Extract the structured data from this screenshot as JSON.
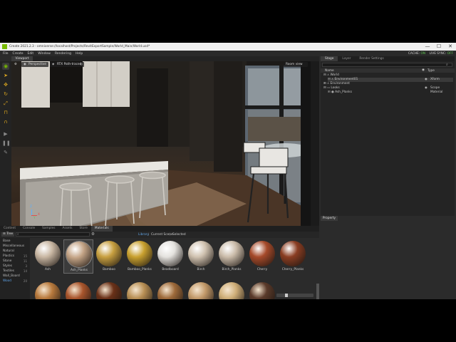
{
  "window": {
    "title": "Create 2021.2.3 - omniverse://localhost/Projects/RevitExportSample/World_Main/World.usd*",
    "controls": [
      "—",
      "☐",
      "✕"
    ]
  },
  "menu": {
    "items": [
      "File",
      "Create",
      "Edit",
      "Window",
      "Rendering",
      "Help"
    ],
    "cache_label": "CACHE:",
    "cache_value": "ON",
    "live_sync_label": "LIVE SYNC:",
    "live_sync_value": "OFF"
  },
  "viewport": {
    "tab_label": "Viewport",
    "camera": "Perspective",
    "renderer": "RTX Path-traced",
    "overlay": "Room view",
    "axis_z": "Z",
    "axis_x": "X",
    "axis_y": "Y"
  },
  "stage": {
    "tabs": [
      "Stage",
      "Layer",
      "Render Settings"
    ],
    "active_tab": "Stage",
    "columns": [
      "Name",
      "Type"
    ],
    "rows": [
      {
        "name": "World",
        "type": "",
        "indent": 0
      },
      {
        "name": "Environment01",
        "type": "Xform",
        "indent": 1
      },
      {
        "name": "Environment",
        "type": "",
        "indent": 0
      },
      {
        "name": "Looks",
        "type": "Scope",
        "indent": 0
      },
      {
        "name": "Ash_Planks",
        "type": "Material",
        "indent": 1
      }
    ]
  },
  "property": {
    "tab_label": "Property"
  },
  "bottom": {
    "tabs": [
      "Content",
      "Console",
      "Samples",
      "Assets",
      "Store",
      "Materials"
    ],
    "active_tab": "Materials",
    "tree_label": "Tree",
    "filters": [
      "Library",
      "Current Scene",
      "Selected"
    ],
    "categories": [
      {
        "label": "Base",
        "count": ""
      },
      {
        "label": "Miscellaneous",
        "count": ""
      },
      {
        "label": "Natural",
        "count": ""
      },
      {
        "label": "Plastics",
        "count": "15"
      },
      {
        "label": "Stone",
        "count": "11"
      },
      {
        "label": "Styles",
        "count": "3"
      },
      {
        "label": "Textiles",
        "count": "14"
      },
      {
        "label": "Wall_Board",
        "count": ""
      },
      {
        "label": "Wood",
        "count": "20"
      }
    ],
    "materials": [
      {
        "name": "Ash",
        "color": "#c9b7a3"
      },
      {
        "name": "Ash_Planks",
        "color": "#c4a486"
      },
      {
        "name": "Bamboo",
        "color": "#c8a040"
      },
      {
        "name": "Bamboo_Planks",
        "color": "#c9a12f"
      },
      {
        "name": "Beadboard",
        "color": "#e4e2de"
      },
      {
        "name": "Birch",
        "color": "#d0c2b0"
      },
      {
        "name": "Birch_Planks",
        "color": "#cbbcaa"
      },
      {
        "name": "Cherry",
        "color": "#a64a2a"
      },
      {
        "name": "Cherry_Planks",
        "color": "#8a3d22"
      }
    ],
    "second_row_colors": [
      "#b87a3d",
      "#a9552c",
      "#6a3118",
      "#b99055",
      "#9e6a3a",
      "#c39a6a",
      "#cfae78",
      "#5a3a2a"
    ]
  },
  "colors": {
    "accent_green": "#76b900",
    "tool_orange": "#d9a520",
    "selection_blue": "#3a7bd5"
  }
}
